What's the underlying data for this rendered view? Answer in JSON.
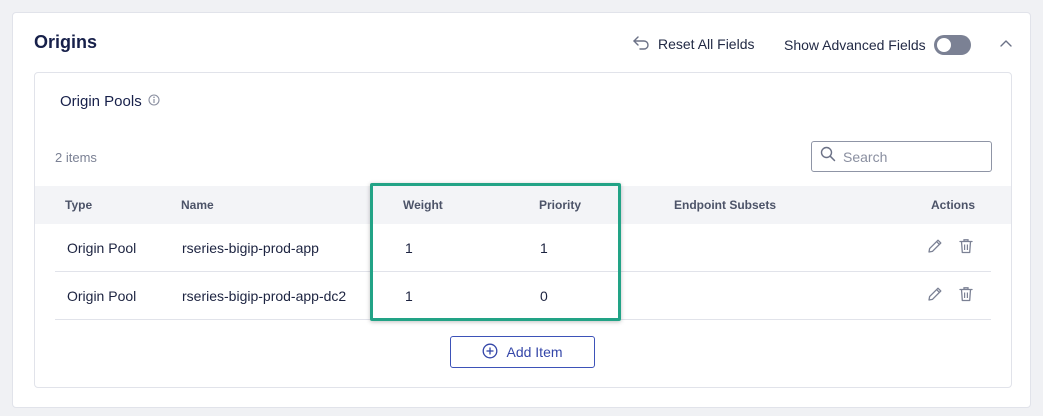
{
  "card": {
    "title": "Origins",
    "reset_label": "Reset All Fields",
    "advanced_label": "Show Advanced Fields",
    "advanced_enabled": false
  },
  "pools": {
    "title": "Origin Pools",
    "count_label": "2 items",
    "search_placeholder": "Search",
    "columns": {
      "type": "Type",
      "name": "Name",
      "weight": "Weight",
      "priority": "Priority",
      "endpoint": "Endpoint Subsets",
      "actions": "Actions"
    },
    "rows": [
      {
        "type": "Origin Pool",
        "name": "rseries-bigip-prod-app",
        "weight": "1",
        "priority": "1",
        "endpoint": ""
      },
      {
        "type": "Origin Pool",
        "name": "rseries-bigip-prod-app-dc2",
        "weight": "1",
        "priority": "0",
        "endpoint": ""
      }
    ],
    "add_label": "Add Item"
  },
  "icons": {
    "reset": "undo-arrow-icon",
    "collapse": "chevron-up-icon",
    "info": "info-icon",
    "search": "search-icon",
    "edit": "pencil-icon",
    "delete": "trash-icon",
    "add": "plus-circle-icon"
  },
  "colors": {
    "accent": "#3446a8",
    "highlight": "#22a386",
    "toggle_off": "#7b8194"
  }
}
